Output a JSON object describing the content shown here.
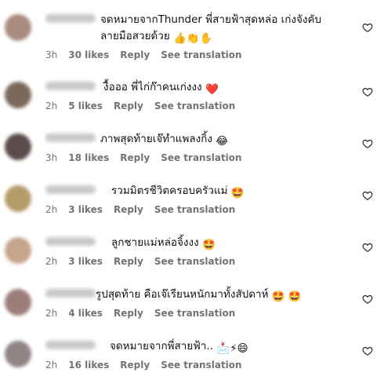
{
  "icons": {
    "like": "heart-outline-icon"
  },
  "colors": {
    "meta_text": "#737373",
    "heart_emoji": "#e0245e",
    "face_emoji": "#f5b21b"
  },
  "comments": [
    {
      "text": "จดหมายจากThunder พี่สายฟ้าสุดหล่อ เก่งจังคับลายมือสวยด้วย",
      "emoji": "👍👏✋",
      "time": "3h",
      "likes": "30 likes",
      "reply": "Reply",
      "translate": "See translation"
    },
    {
      "text": "งื้อออ พี่ไก่ก๊าคนเก่งงง",
      "emoji": "❤️",
      "time": "2h",
      "likes": "5 likes",
      "reply": "Reply",
      "translate": "See translation"
    },
    {
      "text": "ภาพสุดท้ายเจ๊ทำแพลงกิ้ง",
      "emoji": "😂",
      "time": "3h",
      "likes": "18 likes",
      "reply": "Reply",
      "translate": "See translation"
    },
    {
      "text": "รวมมิตรชีวิตครอบครัวแม่",
      "emoji": "🤩",
      "time": "2h",
      "likes": "3 likes",
      "reply": "Reply",
      "translate": "See translation"
    },
    {
      "text": "ลูกชายแม่หล่อจิ้งงง",
      "emoji": "🤩",
      "time": "2h",
      "likes": "3 likes",
      "reply": "Reply",
      "translate": "See translation"
    },
    {
      "text": "รูปสุดท้าย คือเจ๊เรียนหนักมาทั้งสัปดาห์",
      "emoji": "🤩 🤩",
      "time": "2h",
      "likes": "4 likes",
      "reply": "Reply",
      "translate": "See translation"
    },
    {
      "text": "จดหมายจากพี่สายฟ้า..",
      "emoji": "📩⚡😄",
      "time": "2h",
      "likes": "16 likes",
      "reply": "Reply",
      "translate": "See translation"
    }
  ]
}
